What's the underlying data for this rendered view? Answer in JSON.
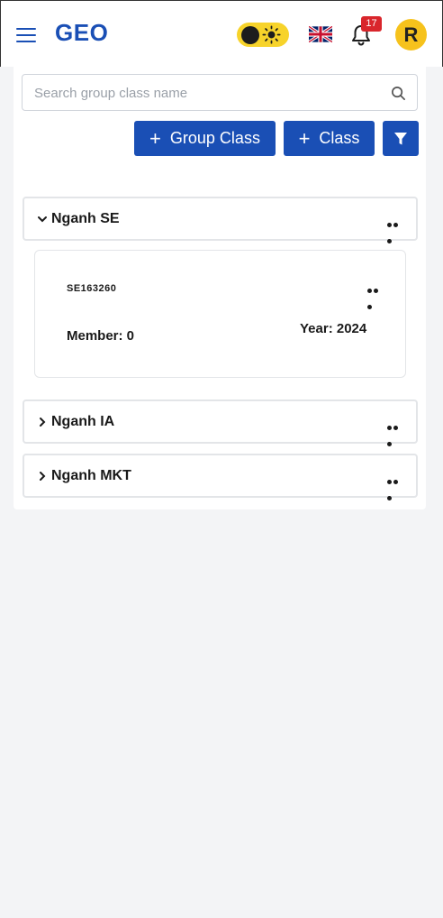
{
  "header": {
    "logo": "GEO",
    "notification_count": "17",
    "avatar_initial": "R"
  },
  "search": {
    "placeholder": "Search group class name"
  },
  "toolbar": {
    "group_class_label": "Group Class",
    "class_label": "Class",
    "plus": "+"
  },
  "groups": [
    {
      "name": "Nganh SE",
      "expanded": true,
      "classes": [
        {
          "code": "SE163260",
          "member_label": "Member: 0",
          "year_label": "Year: 2024"
        }
      ]
    },
    {
      "name": "Nganh IA",
      "expanded": false
    },
    {
      "name": "Nganh MKT",
      "expanded": false
    }
  ],
  "colors": {
    "primary": "#1a4fb5",
    "toggle": "#f7d32a",
    "avatar": "#f6c21c",
    "badge": "#d9262c"
  }
}
